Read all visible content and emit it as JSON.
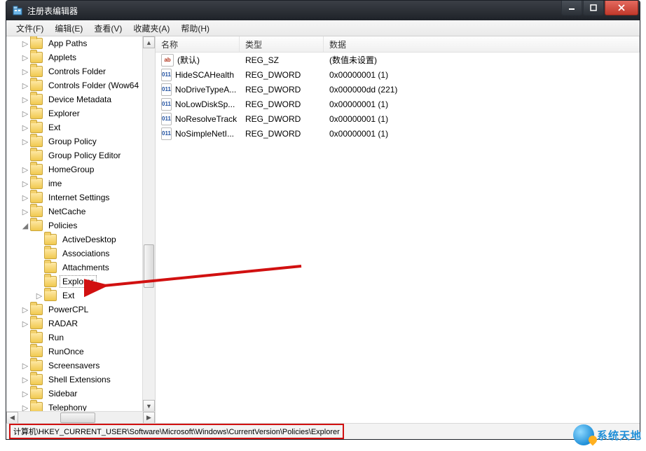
{
  "window": {
    "title": "注册表编辑器"
  },
  "menu": {
    "file": "文件(F)",
    "edit": "编辑(E)",
    "view": "查看(V)",
    "favorites": "收藏夹(A)",
    "help": "帮助(H)"
  },
  "tree": {
    "items": [
      {
        "label": "App Paths",
        "depth": 1,
        "exp": "closed"
      },
      {
        "label": "Applets",
        "depth": 1,
        "exp": "closed"
      },
      {
        "label": "Controls Folder",
        "depth": 1,
        "exp": "closed"
      },
      {
        "label": "Controls Folder (Wow64",
        "depth": 1,
        "exp": "closed"
      },
      {
        "label": "Device Metadata",
        "depth": 1,
        "exp": "closed"
      },
      {
        "label": "Explorer",
        "depth": 1,
        "exp": "closed"
      },
      {
        "label": "Ext",
        "depth": 1,
        "exp": "closed"
      },
      {
        "label": "Group Policy",
        "depth": 1,
        "exp": "closed"
      },
      {
        "label": "Group Policy Editor",
        "depth": 1,
        "exp": "none"
      },
      {
        "label": "HomeGroup",
        "depth": 1,
        "exp": "closed"
      },
      {
        "label": "ime",
        "depth": 1,
        "exp": "closed"
      },
      {
        "label": "Internet Settings",
        "depth": 1,
        "exp": "closed"
      },
      {
        "label": "NetCache",
        "depth": 1,
        "exp": "closed"
      },
      {
        "label": "Policies",
        "depth": 1,
        "exp": "open"
      },
      {
        "label": "ActiveDesktop",
        "depth": 2,
        "exp": "none"
      },
      {
        "label": "Associations",
        "depth": 2,
        "exp": "none"
      },
      {
        "label": "Attachments",
        "depth": 2,
        "exp": "none"
      },
      {
        "label": "Explorer",
        "depth": 2,
        "exp": "none",
        "selected": true
      },
      {
        "label": "Ext",
        "depth": 2,
        "exp": "closed"
      },
      {
        "label": "PowerCPL",
        "depth": 1,
        "exp": "closed"
      },
      {
        "label": "RADAR",
        "depth": 1,
        "exp": "closed"
      },
      {
        "label": "Run",
        "depth": 1,
        "exp": "none"
      },
      {
        "label": "RunOnce",
        "depth": 1,
        "exp": "none"
      },
      {
        "label": "Screensavers",
        "depth": 1,
        "exp": "closed"
      },
      {
        "label": "Shell Extensions",
        "depth": 1,
        "exp": "closed"
      },
      {
        "label": "Sidebar",
        "depth": 1,
        "exp": "closed"
      },
      {
        "label": "Telephony",
        "depth": 1,
        "exp": "closed"
      }
    ]
  },
  "list": {
    "columns": {
      "name": "名称",
      "type": "类型",
      "data": "数据"
    },
    "rows": [
      {
        "icon": "str",
        "name": "(默认)",
        "type": "REG_SZ",
        "data": "(数值未设置)"
      },
      {
        "icon": "bin",
        "name": "HideSCAHealth",
        "type": "REG_DWORD",
        "data": "0x00000001 (1)"
      },
      {
        "icon": "bin",
        "name": "NoDriveTypeA...",
        "type": "REG_DWORD",
        "data": "0x000000dd (221)"
      },
      {
        "icon": "bin",
        "name": "NoLowDiskSp...",
        "type": "REG_DWORD",
        "data": "0x00000001 (1)"
      },
      {
        "icon": "bin",
        "name": "NoResolveTrack",
        "type": "REG_DWORD",
        "data": "0x00000001 (1)"
      },
      {
        "icon": "bin",
        "name": "NoSimpleNetI...",
        "type": "REG_DWORD",
        "data": "0x00000001 (1)"
      }
    ]
  },
  "status": {
    "path": "计算机\\HKEY_CURRENT_USER\\Software\\Microsoft\\Windows\\CurrentVersion\\Policies\\Explorer"
  },
  "watermark": {
    "text": "系统天地"
  },
  "icons": {
    "str": "ab",
    "bin": "011"
  }
}
